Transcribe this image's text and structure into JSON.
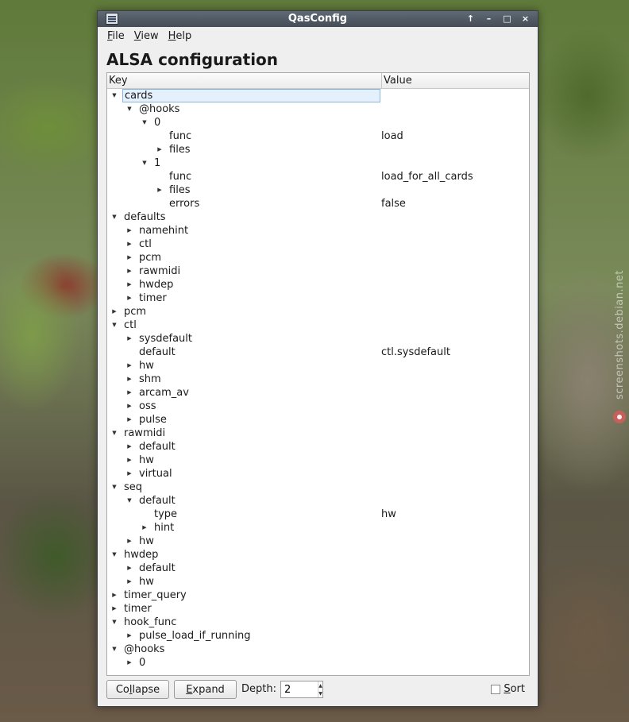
{
  "window": {
    "title": "QasConfig",
    "buttons": [
      "↑",
      "–",
      "□",
      "×"
    ]
  },
  "menu": [
    {
      "label": "File",
      "mnemonic": "F",
      "rest": "ile"
    },
    {
      "label": "View",
      "mnemonic": "V",
      "rest": "iew"
    },
    {
      "label": "Help",
      "mnemonic": "H",
      "rest": "elp"
    }
  ],
  "heading": "ALSA configuration",
  "tree": {
    "columns": {
      "key": "Key",
      "value": "Value"
    },
    "rows": [
      {
        "depth": 0,
        "key": "cards",
        "value": "",
        "state": "expanded",
        "selected": true
      },
      {
        "depth": 1,
        "key": "@hooks",
        "value": "",
        "state": "expanded"
      },
      {
        "depth": 2,
        "key": "0",
        "value": "",
        "state": "expanded"
      },
      {
        "depth": 3,
        "key": "func",
        "value": "load",
        "state": "leaf"
      },
      {
        "depth": 3,
        "key": "files",
        "value": "",
        "state": "collapsed"
      },
      {
        "depth": 2,
        "key": "1",
        "value": "",
        "state": "expanded"
      },
      {
        "depth": 3,
        "key": "func",
        "value": "load_for_all_cards",
        "state": "leaf"
      },
      {
        "depth": 3,
        "key": "files",
        "value": "",
        "state": "collapsed"
      },
      {
        "depth": 3,
        "key": "errors",
        "value": "false",
        "state": "leaf"
      },
      {
        "depth": 0,
        "key": "defaults",
        "value": "",
        "state": "expanded"
      },
      {
        "depth": 1,
        "key": "namehint",
        "value": "",
        "state": "collapsed"
      },
      {
        "depth": 1,
        "key": "ctl",
        "value": "",
        "state": "collapsed"
      },
      {
        "depth": 1,
        "key": "pcm",
        "value": "",
        "state": "collapsed"
      },
      {
        "depth": 1,
        "key": "rawmidi",
        "value": "",
        "state": "collapsed"
      },
      {
        "depth": 1,
        "key": "hwdep",
        "value": "",
        "state": "collapsed"
      },
      {
        "depth": 1,
        "key": "timer",
        "value": "",
        "state": "collapsed"
      },
      {
        "depth": 0,
        "key": "pcm",
        "value": "",
        "state": "collapsed"
      },
      {
        "depth": 0,
        "key": "ctl",
        "value": "",
        "state": "expanded"
      },
      {
        "depth": 1,
        "key": "sysdefault",
        "value": "",
        "state": "collapsed"
      },
      {
        "depth": 1,
        "key": "default",
        "value": "ctl.sysdefault",
        "state": "leaf"
      },
      {
        "depth": 1,
        "key": "hw",
        "value": "",
        "state": "collapsed"
      },
      {
        "depth": 1,
        "key": "shm",
        "value": "",
        "state": "collapsed"
      },
      {
        "depth": 1,
        "key": "arcam_av",
        "value": "",
        "state": "collapsed"
      },
      {
        "depth": 1,
        "key": "oss",
        "value": "",
        "state": "collapsed"
      },
      {
        "depth": 1,
        "key": "pulse",
        "value": "",
        "state": "collapsed"
      },
      {
        "depth": 0,
        "key": "rawmidi",
        "value": "",
        "state": "expanded"
      },
      {
        "depth": 1,
        "key": "default",
        "value": "",
        "state": "collapsed"
      },
      {
        "depth": 1,
        "key": "hw",
        "value": "",
        "state": "collapsed"
      },
      {
        "depth": 1,
        "key": "virtual",
        "value": "",
        "state": "collapsed"
      },
      {
        "depth": 0,
        "key": "seq",
        "value": "",
        "state": "expanded"
      },
      {
        "depth": 1,
        "key": "default",
        "value": "",
        "state": "expanded"
      },
      {
        "depth": 2,
        "key": "type",
        "value": "hw",
        "state": "leaf"
      },
      {
        "depth": 2,
        "key": "hint",
        "value": "",
        "state": "collapsed"
      },
      {
        "depth": 1,
        "key": "hw",
        "value": "",
        "state": "collapsed"
      },
      {
        "depth": 0,
        "key": "hwdep",
        "value": "",
        "state": "expanded"
      },
      {
        "depth": 1,
        "key": "default",
        "value": "",
        "state": "collapsed"
      },
      {
        "depth": 1,
        "key": "hw",
        "value": "",
        "state": "collapsed"
      },
      {
        "depth": 0,
        "key": "timer_query",
        "value": "",
        "state": "collapsed"
      },
      {
        "depth": 0,
        "key": "timer",
        "value": "",
        "state": "collapsed"
      },
      {
        "depth": 0,
        "key": "hook_func",
        "value": "",
        "state": "expanded"
      },
      {
        "depth": 1,
        "key": "pulse_load_if_running",
        "value": "",
        "state": "collapsed"
      },
      {
        "depth": 0,
        "key": "@hooks",
        "value": "",
        "state": "expanded"
      },
      {
        "depth": 1,
        "key": "0",
        "value": "",
        "state": "collapsed"
      }
    ]
  },
  "controls": {
    "collapse": {
      "label": "Collapse",
      "pre": "Co",
      "mnemonic": "l",
      "post": "lapse"
    },
    "expand": {
      "label": "Expand",
      "pre": "",
      "mnemonic": "E",
      "post": "xpand"
    },
    "depth_label": "Depth:",
    "depth_value": "2",
    "sort": {
      "label": "Sort",
      "mnemonic": "S",
      "post": "ort",
      "checked": false
    }
  },
  "watermark": "screenshots.debian.net"
}
